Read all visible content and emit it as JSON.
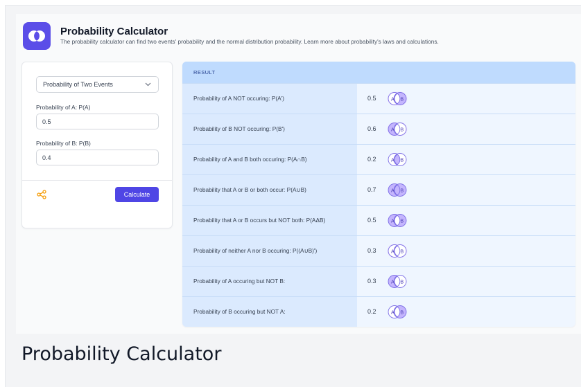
{
  "header": {
    "logo_icon": "overlapping-circles-icon",
    "title": "Probability Calculator",
    "subtitle": "The probability calculator can find two events' probability and the normal distribution probability. Learn more about probability's laws and calculations."
  },
  "form": {
    "mode_select": "Probability of Two Events",
    "prob_a_label": "Probability of A: P(A)",
    "prob_a_value": "0.5",
    "prob_b_label": "Probability of B: P(B)",
    "prob_b_value": "0.4",
    "share_icon": "share-icon",
    "calculate_label": "Calculate"
  },
  "result": {
    "header": "RESULT",
    "rows": [
      {
        "label": "Probability of A NOT occuring: P(A')",
        "value": "0.5",
        "shade": "not-a"
      },
      {
        "label": "Probability of B NOT occuring: P(B')",
        "value": "0.6",
        "shade": "not-b"
      },
      {
        "label": "Probability of A and B both occuring: P(A∩B)",
        "value": "0.2",
        "shade": "intersection"
      },
      {
        "label": "Probability that A or B or both occur: P(A∪B)",
        "value": "0.7",
        "shade": "union"
      },
      {
        "label": "Probability that A or B occurs but NOT both: P(AΔB)",
        "value": "0.5",
        "shade": "symmetric-difference"
      },
      {
        "label": "Probability of neither A nor B occuring: P((A∪B)')",
        "value": "0.3",
        "shade": "neither"
      },
      {
        "label": "Probability of A occuring but NOT B:",
        "value": "0.3",
        "shade": "a-only"
      },
      {
        "label": "Probability of B occuring but NOT A:",
        "value": "0.2",
        "shade": "b-only"
      }
    ]
  },
  "colors": {
    "accent": "#4f46e5",
    "venn_fill": "#c4b5fd",
    "venn_stroke": "#7c6ee6",
    "share_icon": "#f59e0b"
  },
  "caption": "Probability Calculator"
}
